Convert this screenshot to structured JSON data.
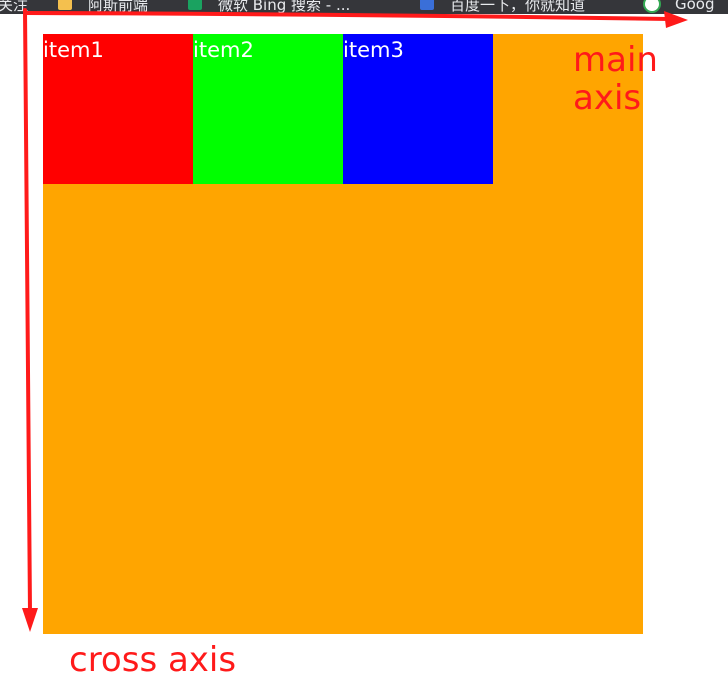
{
  "bookmarks": {
    "items": [
      {
        "label": "关注",
        "icon": "none"
      },
      {
        "label": "阿斯前端",
        "icon": "folder-icon"
      },
      {
        "label": "微软 Bing 搜索 - ...",
        "icon": "bing-icon"
      },
      {
        "label": "百度一下，你就知道",
        "icon": "baidu-icon"
      },
      {
        "label": "Goog",
        "icon": "google-icon"
      }
    ]
  },
  "flex_container": {
    "background": "#ffa500",
    "items": [
      {
        "label": "item1",
        "color": "#ff0000"
      },
      {
        "label": "item2",
        "color": "#00ff00"
      },
      {
        "label": "item3",
        "color": "#0000ff"
      }
    ]
  },
  "annotations": {
    "main_axis_line1": "main",
    "main_axis_line2": "axis",
    "cross_axis": "cross axis",
    "arrow_color": "#ff1a1a"
  }
}
